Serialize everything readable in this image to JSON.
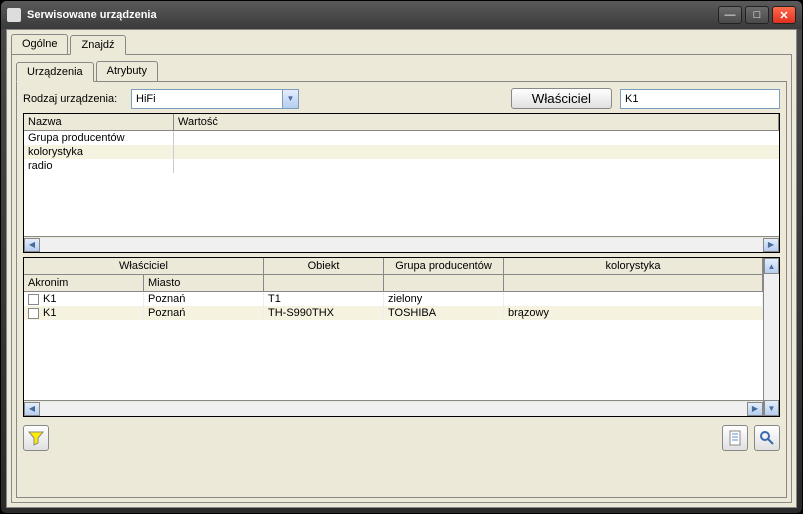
{
  "window": {
    "title": "Serwisowane urządzenia"
  },
  "tabs_top": {
    "ogolne": "Ogólne",
    "znajdz": "Znajdź"
  },
  "sub_tabs": {
    "urzadzenia": "Urządzenia",
    "atrybuty": "Atrybuty"
  },
  "form": {
    "rodzaj_label": "Rodzaj urządzenia:",
    "rodzaj_value": "HiFi",
    "wlasciciel_btn": "Właściciel",
    "wlasciciel_value": "K1"
  },
  "grid1": {
    "headers": {
      "nazwa": "Nazwa",
      "wartosc": "Wartość"
    },
    "rows": [
      {
        "nazwa": "Grupa producentów"
      },
      {
        "nazwa": "kolorystyka"
      },
      {
        "nazwa": "radio"
      }
    ]
  },
  "grid2": {
    "headers1": {
      "wlasciciel": "Właściciel",
      "obiekt": "Obiekt",
      "grupa": "Grupa producentów",
      "kolorystyka": "kolorystyka"
    },
    "headers2": {
      "akronim": "Akronim",
      "miasto": "Miasto"
    },
    "rows": [
      {
        "akronim": "K1",
        "miasto": "Poznań",
        "obiekt": "T1",
        "grupa": "zielony",
        "kolorystyka": ""
      },
      {
        "akronim": "K1",
        "miasto": "Poznań",
        "obiekt": "TH-S990THX",
        "grupa": "TOSHIBA",
        "kolorystyka": "brązowy"
      }
    ]
  }
}
